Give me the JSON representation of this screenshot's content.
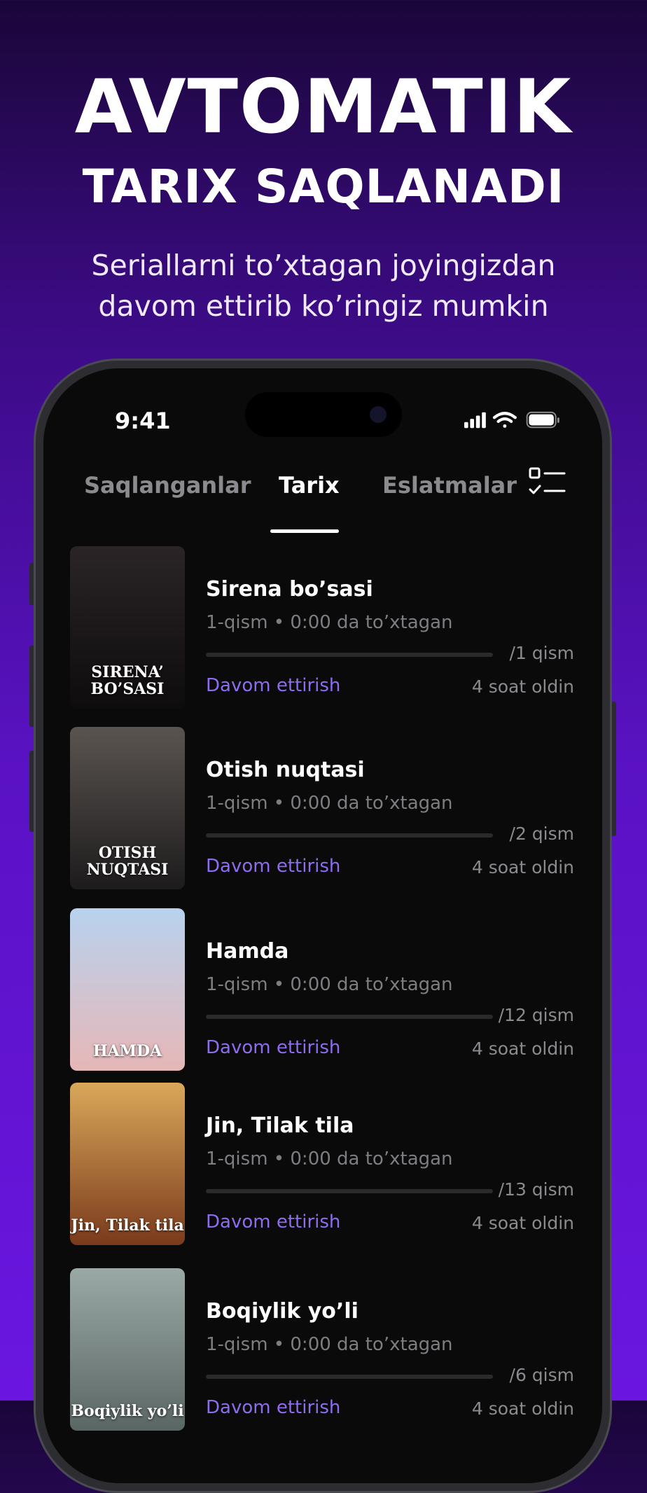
{
  "promo": {
    "title": "AVTOMATIK",
    "subtitle": "TARIX SAQLANADI",
    "description_line1": "Seriallarni to’xtagan joyingizdan",
    "description_line2": "davom ettirib ko’ringiz mumkin"
  },
  "status_bar": {
    "time": "9:41"
  },
  "tabs": [
    {
      "label": "Saqlanganlar",
      "active": false
    },
    {
      "label": "Tarix",
      "active": true
    },
    {
      "label": "Eslatmalar",
      "active": false
    }
  ],
  "history": [
    {
      "title": "Sirena bo’sasi",
      "poster_text": "SIRENA’ BO’SASI",
      "meta": "1-qism • 0:00 da to’xtagan",
      "episodes": "/1 qism",
      "continue_label": "Davom ettirish",
      "time_ago": "4 soat oldin",
      "progress": 0,
      "poster_colors": [
        "#2a2426",
        "#0e0c0d"
      ]
    },
    {
      "title": "Otish nuqtasi",
      "poster_text": "OTISH NUQTASI",
      "meta": "1-qism • 0:00 da to’xtagan",
      "episodes": "/2 qism",
      "continue_label": "Davom ettirish",
      "time_ago": "4 soat oldin",
      "progress": 0,
      "poster_colors": [
        "#5a5450",
        "#1d1b1c"
      ]
    },
    {
      "title": "Hamda",
      "poster_text": "HAMDA",
      "meta": "1-qism • 0:00 da to’xtagan",
      "episodes": "/12 qism",
      "continue_label": "Davom ettirish",
      "time_ago": "4 soat oldin",
      "progress": 0,
      "poster_colors": [
        "#b8d2ee",
        "#e6b7b7"
      ]
    },
    {
      "title": "Jin, Tilak tila",
      "poster_text": "Jin, Tilak tila",
      "meta": "1-qism • 0:00 da to’xtagan",
      "episodes": "/13 qism",
      "continue_label": "Davom ettirish",
      "time_ago": "4 soat oldin",
      "progress": 0,
      "poster_colors": [
        "#d9a85a",
        "#7a3a1c"
      ]
    },
    {
      "title": "Boqiylik yo’li",
      "poster_text": "Boqiylik yo’li",
      "meta": "1-qism • 0:00 da to’xtagan",
      "episodes": "/6 qism",
      "continue_label": "Davom ettirish",
      "time_ago": "4 soat oldin",
      "progress": 0,
      "poster_colors": [
        "#9aa8a6",
        "#5a6664"
      ]
    }
  ],
  "colors": {
    "accent": "#8e6cf0",
    "background_top": "#1a0638",
    "background_bottom": "#6a16e0",
    "screen": "#0a0a0a"
  }
}
